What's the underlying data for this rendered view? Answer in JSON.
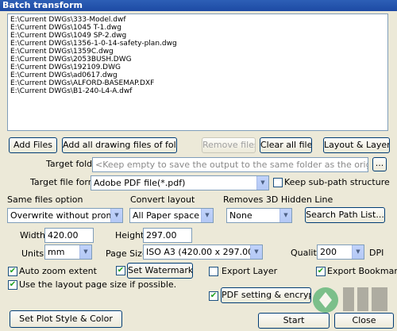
{
  "window": {
    "title": "Batch transform"
  },
  "files": [
    "E:\\Current DWGs\\333-Model.dwf",
    "E:\\Current DWGs\\1045 T-1.dwg",
    "E:\\Current DWGs\\1049 SP-2.dwg",
    "E:\\Current DWGs\\1356-1-0-14-safety-plan.dwg",
    "E:\\Current DWGs\\1359C.dwg",
    "E:\\Current DWGs\\2053BUSH.DWG",
    "E:\\Current DWGs\\192109.DWG",
    "E:\\Current DWGs\\ad0617.dwg",
    "E:\\Current DWGs\\ALFORD-BASEMAP.DXF",
    "E:\\Current DWGs\\B1-240-L4-A.dwf"
  ],
  "buttons": {
    "add_files": "Add Files",
    "add_all": "Add all drawing files of folder",
    "remove_files": "Remove files",
    "clear_all": "Clear all files",
    "layout_layer": "Layout & Layer...",
    "browse": "...",
    "search_path": "Search Path List...",
    "set_watermark": "Set Watermark...",
    "pdf_setting": "PDF setting & encrypt...",
    "plot_style": "Set Plot Style & Color",
    "start": "Start",
    "close": "Close"
  },
  "target_folder": {
    "label": "Target folder",
    "placeholder": "<Keep empty to save the output to the same folder as the original drawing>"
  },
  "target_format": {
    "label": "Target file format",
    "value": "Adobe PDF file(*.pdf)"
  },
  "keep_subpath": {
    "label": "Keep sub-path structure",
    "checked": false
  },
  "same_files": {
    "label": "Same files option",
    "value": "Overwrite without prompt"
  },
  "convert_layout": {
    "label": "Convert layout",
    "value": "All Paper space"
  },
  "remove_hidden": {
    "label": "Removes 3D Hidden Line",
    "value": "None"
  },
  "width": {
    "label": "Width",
    "value": "420.00"
  },
  "height": {
    "label": "Height",
    "value": "297.00"
  },
  "units": {
    "label": "Units",
    "value": "mm"
  },
  "page_size": {
    "label": "Page Size",
    "value": "ISO A3 (420.00 x 297.00 MM)"
  },
  "quality": {
    "label": "Quality",
    "value": "200",
    "unit": "DPI"
  },
  "auto_zoom": {
    "label": "Auto zoom extent",
    "checked": true
  },
  "use_layout": {
    "label": "Use the layout page size if possible.",
    "checked": true
  },
  "export_layer": {
    "label": "Export Layer",
    "checked": false
  },
  "export_bookmark": {
    "label": "Export Bookmark",
    "checked": true
  },
  "watermark_checked": true,
  "pdf_checked": true,
  "check_glyph": "✔",
  "arrow_glyph": "▼"
}
